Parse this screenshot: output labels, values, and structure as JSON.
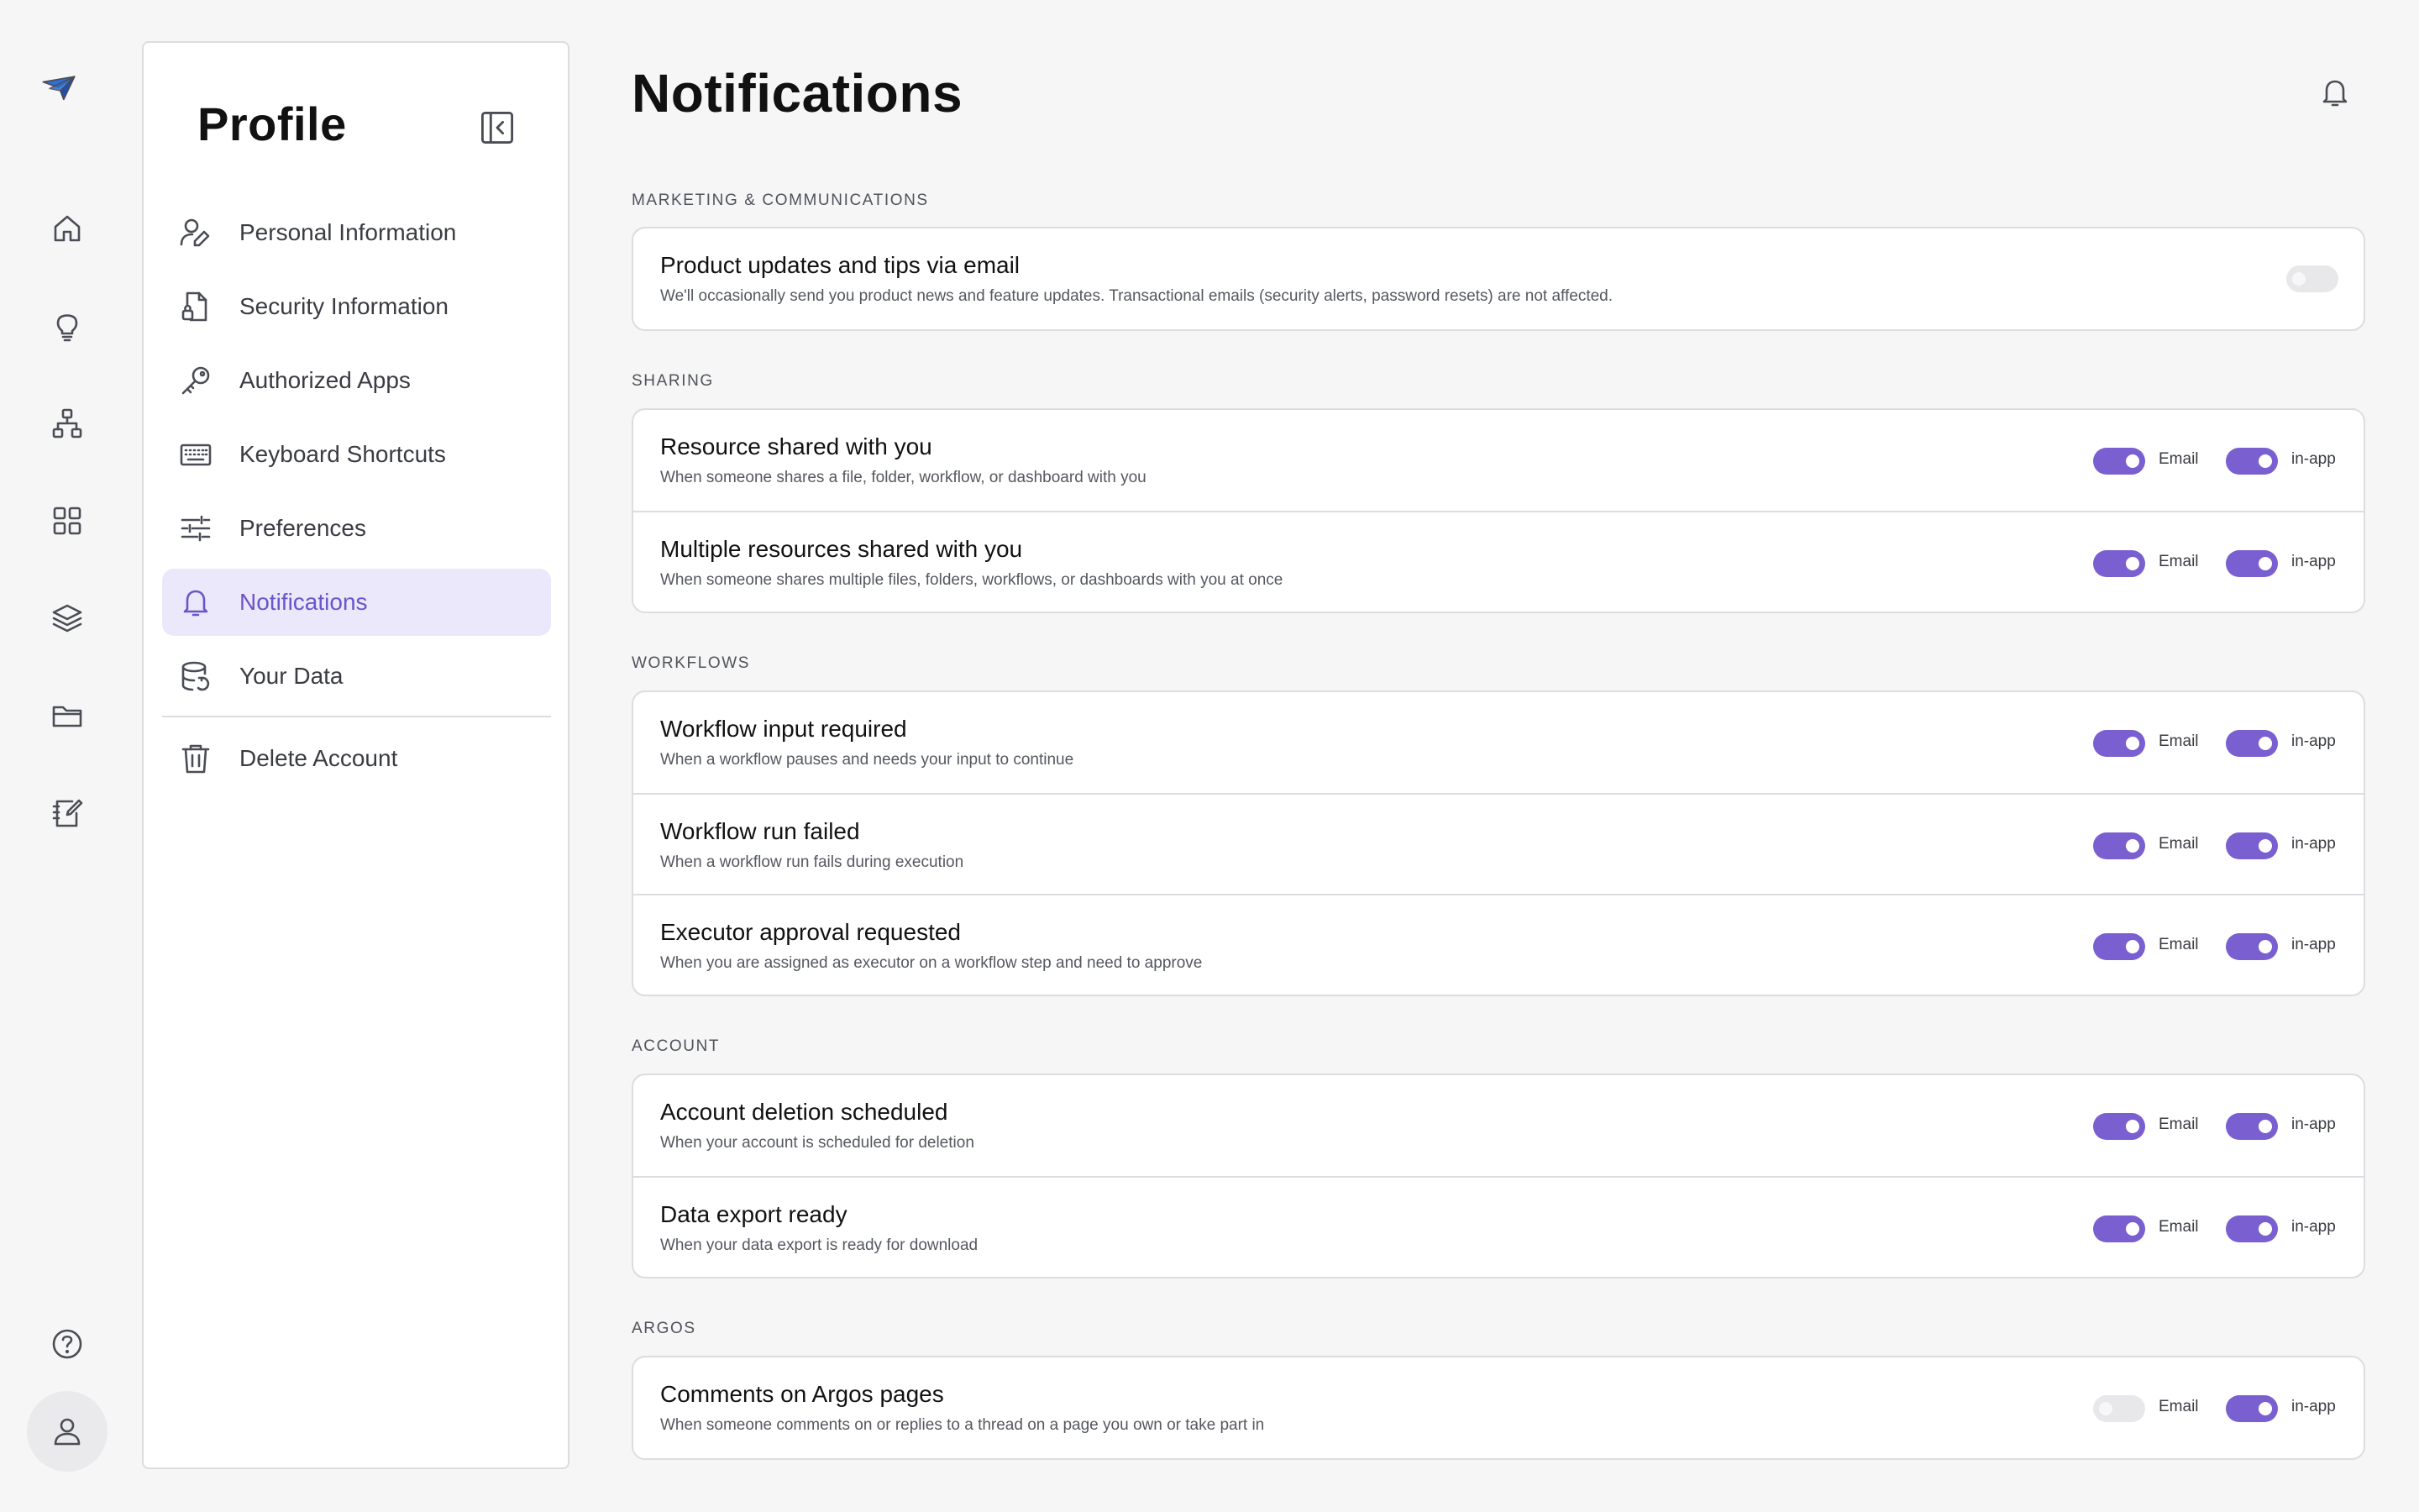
{
  "profile": {
    "title": "Profile",
    "nav": [
      {
        "label": "Personal Information",
        "icon": "user-edit-icon"
      },
      {
        "label": "Security Information",
        "icon": "file-shield-icon"
      },
      {
        "label": "Authorized Apps",
        "icon": "key-icon"
      },
      {
        "label": "Keyboard Shortcuts",
        "icon": "keyboard-icon"
      },
      {
        "label": "Preferences",
        "icon": "sliders-icon"
      },
      {
        "label": "Notifications",
        "icon": "bell-icon",
        "active": true
      },
      {
        "label": "Your Data",
        "icon": "database-icon"
      },
      {
        "label": "Delete Account",
        "icon": "trash-icon"
      }
    ]
  },
  "main": {
    "title": "Notifications",
    "email_label": "Email",
    "inapp_label": "in-app",
    "sections": [
      {
        "label": "MARKETING & COMMUNICATIONS",
        "rows": [
          {
            "title": "Product updates and tips via email",
            "desc": "We'll occasionally send you product news and feature updates. Transactional emails (security alerts, password resets) are not affected.",
            "email": false
          }
        ]
      },
      {
        "label": "SHARING",
        "rows": [
          {
            "title": "Resource shared with you",
            "desc": "When someone shares a file, folder, workflow, or dashboard with you",
            "email": true,
            "inapp": true
          },
          {
            "title": "Multiple resources shared with you",
            "desc": "When someone shares multiple files, folders, workflows, or dashboards with you at once",
            "email": true,
            "inapp": true
          }
        ]
      },
      {
        "label": "WORKFLOWS",
        "rows": [
          {
            "title": "Workflow input required",
            "desc": "When a workflow pauses and needs your input to continue",
            "email": true,
            "inapp": true
          },
          {
            "title": "Workflow run failed",
            "desc": "When a workflow run fails during execution",
            "email": true,
            "inapp": true
          },
          {
            "title": "Executor approval requested",
            "desc": "When you are assigned as executor on a workflow step and need to approve",
            "email": true,
            "inapp": true
          }
        ]
      },
      {
        "label": "ACCOUNT",
        "rows": [
          {
            "title": "Account deletion scheduled",
            "desc": "When your account is scheduled for deletion",
            "email": true,
            "inapp": true
          },
          {
            "title": "Data export ready",
            "desc": "When your data export is ready for download",
            "email": true,
            "inapp": true
          }
        ]
      },
      {
        "label": "ARGOS",
        "rows": [
          {
            "title": "Comments on Argos pages",
            "desc": "When someone comments on or replies to a thread on a page you own or take part in",
            "email": false,
            "inapp": true
          }
        ]
      }
    ]
  },
  "colors": {
    "accent": "#7a5fd0",
    "active_bg": "#ebe8fb",
    "toggle_off": "#e8e8eb",
    "logo": "#2f6fd6"
  },
  "rail_icons": [
    "logo-icon",
    "home-icon",
    "lightbulb-icon",
    "sitemap-icon",
    "grid-icon",
    "layers-icon",
    "folder-icon",
    "notebook-edit-icon",
    "help-icon",
    "avatar-icon"
  ]
}
